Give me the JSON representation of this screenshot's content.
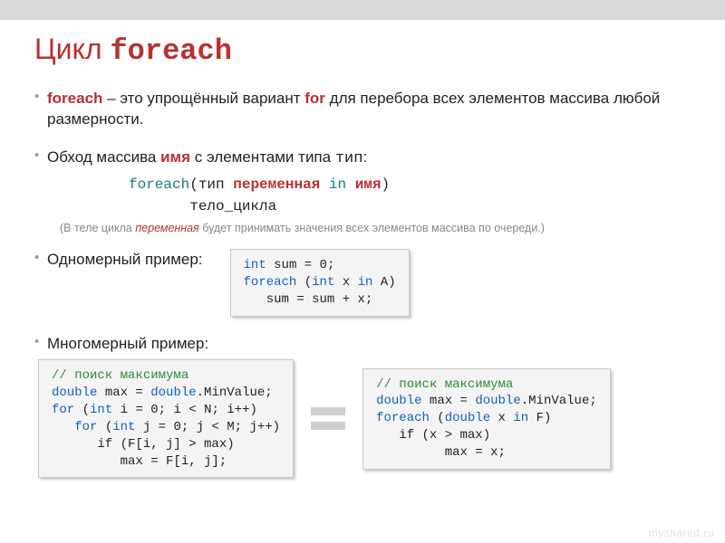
{
  "title": {
    "word1": "Цикл",
    "word2": "foreach"
  },
  "bullet1": {
    "pre": "foreach",
    "mid": " – это упрощённый вариант ",
    "kw": "for",
    "post": " для перебора всех элементов массива любой размерности."
  },
  "bullet2": {
    "p1": "Обход массива ",
    "name": "имя",
    "p2": " с элементами типа ",
    "type": "тип",
    "p3": ":"
  },
  "syntax": {
    "foreach": "foreach",
    "lpar": "(",
    "type": "тип",
    "sp1": " ",
    "var": "переменная",
    "sp2": " ",
    "in": "in",
    "sp3": " ",
    "name": "имя",
    "rpar": ")",
    "body_indent": "       ",
    "body": "тело_цикла"
  },
  "note": {
    "pre": "(В теле цикла ",
    "var": "переменная",
    "post": " будет принимать значения всех элементов массива по очереди.)"
  },
  "bullet3": "Одномерный пример:",
  "code1d": {
    "l1a": "int",
    "l1b": " sum = 0;",
    "l2a": "foreach",
    "l2b": " (",
    "l2c": "int",
    "l2d": " x ",
    "l2e": "in",
    "l2f": " A)",
    "l3": "   sum = sum + x;"
  },
  "bullet4": "Многомерный пример:",
  "codeLeft": {
    "c1": "// поиск максимума",
    "l2a": "double",
    "l2b": " max = ",
    "l2c": "double",
    "l2d": ".MinValue;",
    "l3a": "for",
    "l3b": " (",
    "l3c": "int",
    "l3d": " i = 0; i < N; i++)",
    "l4a": "   for",
    "l4b": " (",
    "l4c": "int",
    "l4d": " j = 0; j < M; j++)",
    "l5": "      if (F[i, j] > max)",
    "l6": "         max = F[i, j];"
  },
  "codeRight": {
    "c1": "// поиск максимума",
    "l2a": "double",
    "l2b": " max = ",
    "l2c": "double",
    "l2d": ".MinValue;",
    "l3a": "foreach",
    "l3b": " (",
    "l3c": "double",
    "l3d": " x ",
    "l3e": "in",
    "l3f": " F)",
    "l4": "   if (x > max)",
    "l5": "         max = x;"
  },
  "watermark": "myshared.ru"
}
